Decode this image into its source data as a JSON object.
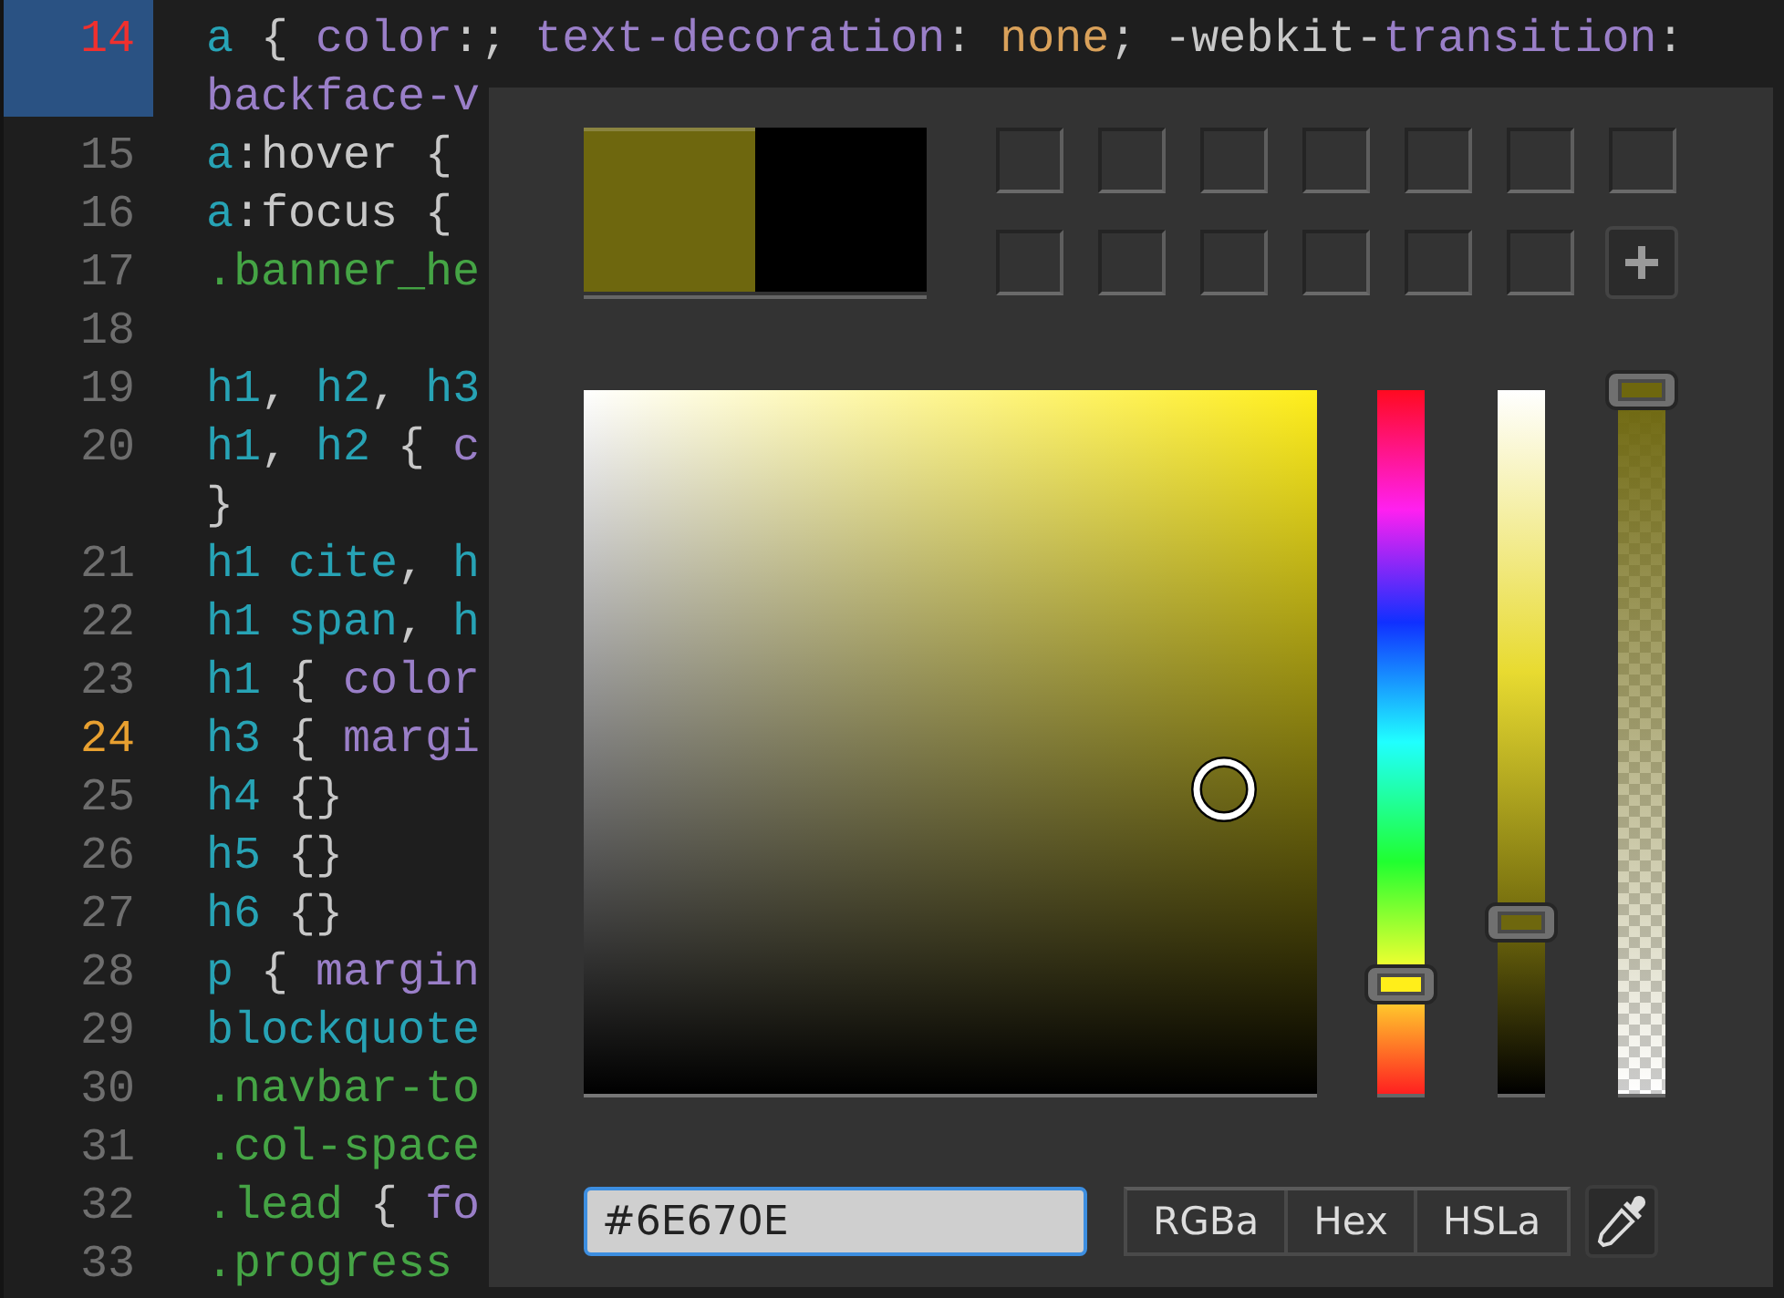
{
  "editor": {
    "lines": [
      {
        "number": "14",
        "error": true,
        "warning": false,
        "selected": true,
        "rows": [
          [
            {
              "kind": "selector",
              "text": "a"
            },
            {
              "kind": "punct",
              "text": " { "
            },
            {
              "kind": "property",
              "text": "color"
            },
            {
              "kind": "punct",
              "text": ":; "
            },
            {
              "kind": "property",
              "text": "text-decoration"
            },
            {
              "kind": "punct",
              "text": ": "
            },
            {
              "kind": "value",
              "text": "none"
            },
            {
              "kind": "punct",
              "text": "; -webkit-"
            },
            {
              "kind": "property",
              "text": "transition"
            },
            {
              "kind": "punct",
              "text": ":"
            }
          ],
          [
            {
              "kind": "property",
              "text": "backface-v"
            }
          ]
        ]
      },
      {
        "number": "15",
        "error": false,
        "warning": false,
        "selected": false,
        "rows": [
          [
            {
              "kind": "selector",
              "text": "a"
            },
            {
              "kind": "punct",
              "text": ":hover {"
            }
          ]
        ]
      },
      {
        "number": "16",
        "error": false,
        "warning": false,
        "selected": false,
        "rows": [
          [
            {
              "kind": "selector",
              "text": "a"
            },
            {
              "kind": "punct",
              "text": ":focus {"
            }
          ]
        ]
      },
      {
        "number": "17",
        "error": false,
        "warning": false,
        "selected": false,
        "rows": [
          [
            {
              "kind": "class",
              "text": ".banner_he"
            }
          ]
        ]
      },
      {
        "number": "18",
        "error": false,
        "warning": false,
        "selected": false
      },
      {
        "number": "19",
        "error": false,
        "warning": false,
        "selected": false,
        "rows": [
          [
            {
              "kind": "selector",
              "text": "h1"
            },
            {
              "kind": "punct",
              "text": ", "
            },
            {
              "kind": "selector",
              "text": "h2"
            },
            {
              "kind": "punct",
              "text": ", "
            },
            {
              "kind": "selector",
              "text": "h3"
            }
          ]
        ]
      },
      {
        "number": "20",
        "error": false,
        "warning": false,
        "selected": false,
        "rows": [
          [
            {
              "kind": "selector",
              "text": "h1"
            },
            {
              "kind": "punct",
              "text": ", "
            },
            {
              "kind": "selector",
              "text": "h2"
            },
            {
              "kind": "punct",
              "text": " { "
            },
            {
              "kind": "property",
              "text": "c"
            }
          ],
          [
            {
              "kind": "punct",
              "text": "}"
            }
          ]
        ]
      },
      {
        "number": "21",
        "error": false,
        "warning": false,
        "selected": false,
        "rows": [
          [
            {
              "kind": "selector",
              "text": "h1 cite"
            },
            {
              "kind": "punct",
              "text": ", "
            },
            {
              "kind": "selector",
              "text": "h"
            }
          ]
        ]
      },
      {
        "number": "22",
        "error": false,
        "warning": false,
        "selected": false,
        "rows": [
          [
            {
              "kind": "selector",
              "text": "h1 span"
            },
            {
              "kind": "punct",
              "text": ", "
            },
            {
              "kind": "selector",
              "text": "h"
            }
          ]
        ]
      },
      {
        "number": "23",
        "error": false,
        "warning": false,
        "selected": false,
        "rows": [
          [
            {
              "kind": "selector",
              "text": "h1"
            },
            {
              "kind": "punct",
              "text": " { "
            },
            {
              "kind": "property",
              "text": "color"
            }
          ]
        ]
      },
      {
        "number": "24",
        "error": false,
        "warning": true,
        "selected": false,
        "rows": [
          [
            {
              "kind": "selector",
              "text": "h3"
            },
            {
              "kind": "punct",
              "text": " { "
            },
            {
              "kind": "property",
              "text": "margi"
            }
          ]
        ]
      },
      {
        "number": "25",
        "error": false,
        "warning": false,
        "selected": false,
        "rows": [
          [
            {
              "kind": "selector",
              "text": "h4"
            },
            {
              "kind": "punct",
              "text": " {}"
            }
          ]
        ]
      },
      {
        "number": "26",
        "error": false,
        "warning": false,
        "selected": false,
        "rows": [
          [
            {
              "kind": "selector",
              "text": "h5"
            },
            {
              "kind": "punct",
              "text": " {}"
            }
          ]
        ]
      },
      {
        "number": "27",
        "error": false,
        "warning": false,
        "selected": false,
        "rows": [
          [
            {
              "kind": "selector",
              "text": "h6"
            },
            {
              "kind": "punct",
              "text": " {}"
            }
          ]
        ]
      },
      {
        "number": "28",
        "error": false,
        "warning": false,
        "selected": false,
        "rows": [
          [
            {
              "kind": "selector",
              "text": "p"
            },
            {
              "kind": "punct",
              "text": " { "
            },
            {
              "kind": "property",
              "text": "margin"
            }
          ]
        ]
      },
      {
        "number": "29",
        "error": false,
        "warning": false,
        "selected": false,
        "rows": [
          [
            {
              "kind": "selector",
              "text": "blockquote"
            }
          ]
        ]
      },
      {
        "number": "30",
        "error": false,
        "warning": false,
        "selected": false,
        "rows": [
          [
            {
              "kind": "class",
              "text": ".navbar-to"
            }
          ]
        ]
      },
      {
        "number": "31",
        "error": false,
        "warning": false,
        "selected": false,
        "rows": [
          [
            {
              "kind": "class",
              "text": ".col-space"
            }
          ]
        ]
      },
      {
        "number": "32",
        "error": false,
        "warning": false,
        "selected": false,
        "rows": [
          [
            {
              "kind": "class",
              "text": ".lead"
            },
            {
              "kind": "punct",
              "text": " { "
            },
            {
              "kind": "property",
              "text": "fo"
            }
          ]
        ]
      },
      {
        "number": "33",
        "error": false,
        "warning": false,
        "selected": false,
        "rows": [
          [
            {
              "kind": "class",
              "text": ".progress"
            }
          ]
        ]
      }
    ]
  },
  "color_picker": {
    "swatches": [
      {
        "kind": "current",
        "color": "#6e670e"
      },
      {
        "kind": "previous",
        "color": "#000000"
      }
    ],
    "presets": [
      {
        "kind": "empty"
      },
      {
        "kind": "empty"
      },
      {
        "kind": "empty"
      },
      {
        "kind": "empty"
      },
      {
        "kind": "empty"
      },
      {
        "kind": "empty"
      },
      {
        "kind": "empty"
      },
      {
        "kind": "empty"
      },
      {
        "kind": "empty"
      },
      {
        "kind": "empty"
      },
      {
        "kind": "empty"
      },
      {
        "kind": "empty"
      },
      {
        "kind": "empty"
      },
      {
        "kind": "add"
      }
    ],
    "alpha": {
      "level": 1
    },
    "hex_field": {
      "value": "#6E670E"
    },
    "modes": [
      {
        "label": "RGBa"
      },
      {
        "label": "Hex"
      },
      {
        "label": "HSLa"
      }
    ]
  }
}
